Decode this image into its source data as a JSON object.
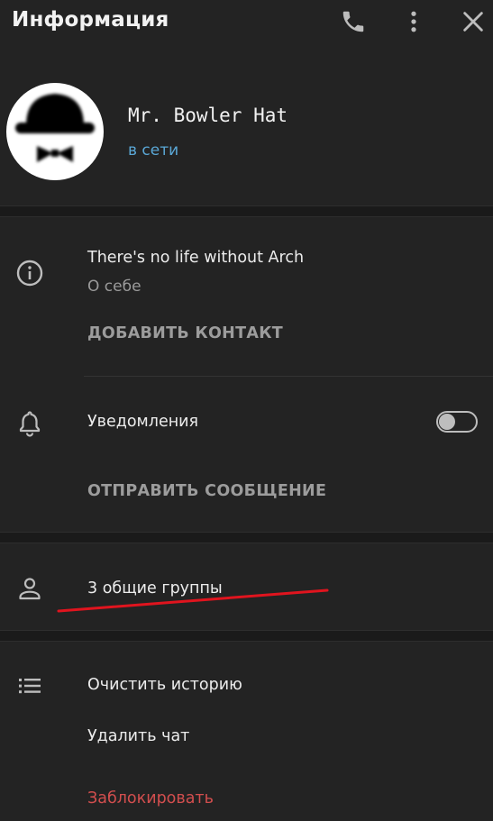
{
  "header": {
    "title": "Информация",
    "icons": [
      "phone-icon",
      "more-vertical-icon",
      "close-icon"
    ]
  },
  "profile": {
    "name": "Mr. Bowler Hat",
    "status": "в сети",
    "status_color": "#5aa7d6"
  },
  "info": {
    "bio": "There's no life without Arch",
    "bio_label": "О себе",
    "add_contact": "ДОБАВИТЬ КОНТАКТ",
    "notifications_label": "Уведомления",
    "notifications_enabled": false,
    "send_message": "ОТПРАВИТЬ СООБЩЕНИЕ"
  },
  "groups": {
    "label": "3 общие группы",
    "annotation_color": "#e0141e"
  },
  "actions": {
    "clear_history": "Очистить историю",
    "delete_chat": "Удалить чат",
    "block": "Заблокировать",
    "block_color": "#d24e4e"
  },
  "colors": {
    "background": "#232323",
    "separator": "#1a1a1a",
    "accent": "#5aa7d6"
  }
}
